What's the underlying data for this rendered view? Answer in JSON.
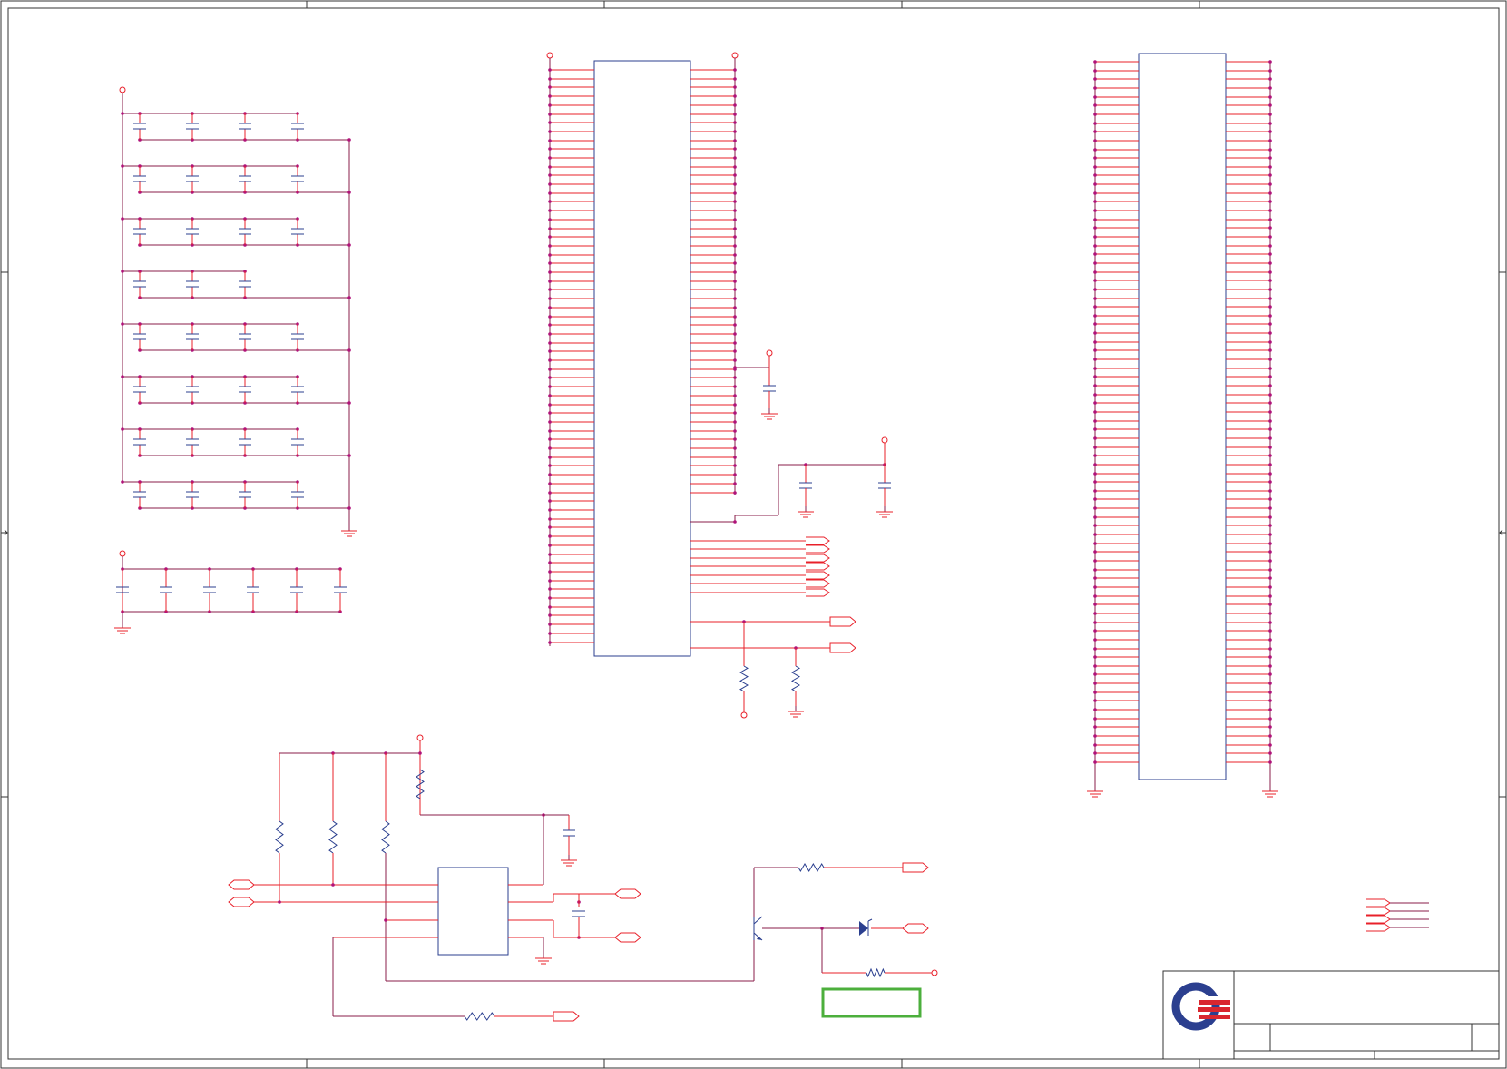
{
  "sheet": {
    "title_block": {
      "logo": "company-logo",
      "title": "",
      "rev": ""
    },
    "colors": {
      "net": "#e8202a",
      "wire": "#8a1c4a",
      "component": "#2b3f8f",
      "border": "#333333",
      "note_box": "#4caf3c",
      "junction": "#b0127a"
    }
  }
}
